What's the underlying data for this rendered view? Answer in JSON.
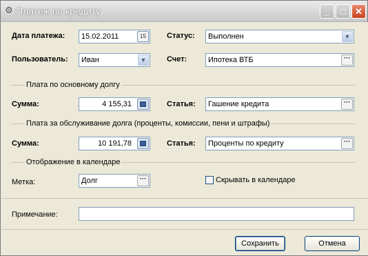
{
  "window": {
    "title": "Платеж по кредиту",
    "icon": "gear-icon",
    "controls": {
      "minimize": "minimize-icon",
      "maximize": "maximize-icon",
      "close": "close-icon"
    }
  },
  "payment": {
    "date_label": "Дата платежа:",
    "date_value": "15.02.2011",
    "calendar_icon": "15",
    "status_label": "Статус:",
    "status_value": "Выполнен",
    "user_label": "Пользователь:",
    "user_value": "Иван",
    "account_label": "Счет:",
    "account_value": "Ипотека ВТБ"
  },
  "principal": {
    "group_title": "Плата по основному долгу",
    "sum_label": "Сумма:",
    "sum_value": "4 155,31",
    "item_label": "Статья:",
    "item_value": "Гашение кредита"
  },
  "service": {
    "group_title": "Плата за обслуживание долга (проценты, комиссии, пени и штрафы)",
    "sum_label": "Сумма:",
    "sum_value": "10 191,78",
    "item_label": "Статья:",
    "item_value": "Проценты по кредиту"
  },
  "calendar": {
    "group_title": "Отображение в календаре",
    "mark_label": "Метка:",
    "mark_value": "Долг",
    "hide_label": "Скрывать в календаре",
    "hide_checked": false
  },
  "note": {
    "label": "Примечание:",
    "value": ""
  },
  "buttons": {
    "save": "Сохранить",
    "cancel": "Отмена",
    "ellipsis": "···"
  },
  "colors": {
    "close_button": "#c8431e",
    "field_border": "#7f9db9",
    "dialog_bg": "#ece9d8"
  }
}
